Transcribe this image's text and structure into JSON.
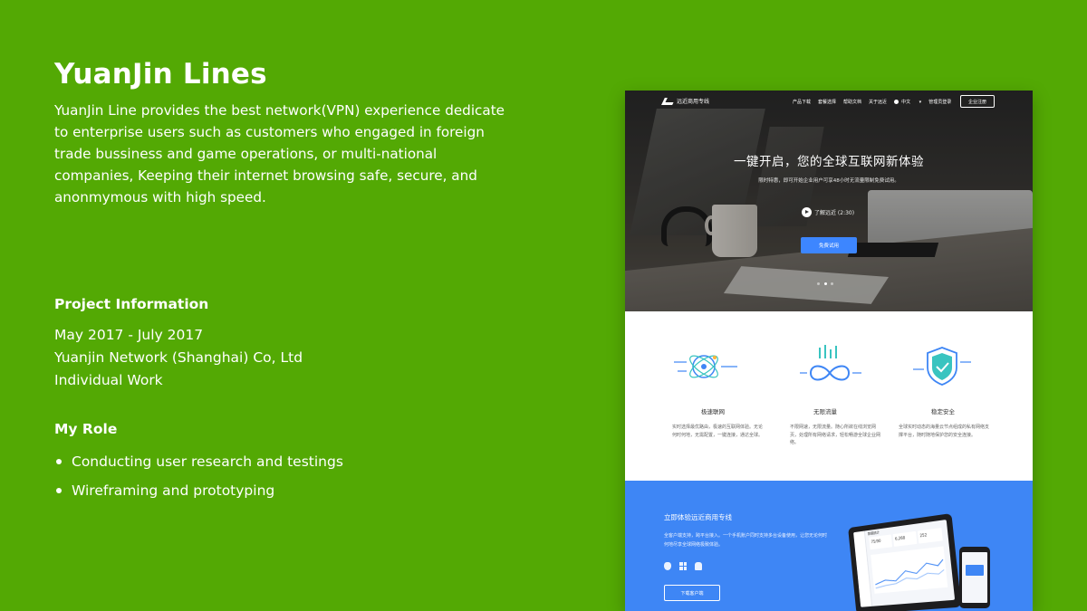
{
  "project": {
    "title": "YuanJin Lines",
    "description": "YuanJin Line provides the best network(VPN) experience dedicate to enterprise users such as customers who engaged in foreign trade bussiness and game operations, or multi-national companies, Keeping their internet browsing safe, secure, and anonmymous with high speed."
  },
  "info": {
    "heading": "Project Information",
    "dates": "May 2017 - July 2017",
    "company": "Yuanjin Network (Shanghai) Co, Ltd",
    "work_type": "Individual Work"
  },
  "role": {
    "heading": "My Role",
    "items": [
      "Conducting user research and testings",
      "Wireframing and prototyping"
    ]
  },
  "mockup": {
    "logo_text": "远近商用专线",
    "nav": [
      "产品下载",
      "套餐选择",
      "帮助文档",
      "关于远近"
    ],
    "lang": "中文",
    "admin_login": "管理员登录",
    "register": "企业注册",
    "hero_title": "一键开启，您的全球互联网新体验",
    "hero_sub": "限时特惠，即可开始企业用户可享48小时无流量限制免费试用。",
    "video_label": "了解远近 (2:30)",
    "trial_button": "免费试用",
    "features": [
      {
        "name": "极速联网",
        "icon": "atom-speed-icon",
        "desc": "实时选择最优路由，极速的互联网体验。无论何时何地，无需配置，一键连接，通达全球。"
      },
      {
        "name": "无限流量",
        "icon": "infinity-icon",
        "desc": "不限网速，无限流量。随心所欲在线浏览网页，处理所有网络请求，轻松畅游全球企业网络。"
      },
      {
        "name": "稳定安全",
        "icon": "shield-check-icon",
        "desc": "全球实时动态的海量云节点组成的私有网络支撑平台，随时随地保护您的安全连接。"
      }
    ],
    "cta": {
      "title": "立即体验远近商用专线",
      "desc": "全客户端支持，跨平台接入。一个手机账户同时支持多台设备使用，让您无论何时何地尽享全球网络极致体验。",
      "platform_icons": [
        "apple-icon",
        "windows-icon",
        "mobile-icon",
        "android-icon"
      ],
      "download_button": "下载客户端",
      "device_stats": [
        "75/90",
        "6,268",
        "252"
      ],
      "device_title": "数据统计"
    }
  },
  "colors": {
    "background": "#53a904",
    "accent_blue": "#3e86f5",
    "button_blue": "#3d86ff"
  }
}
